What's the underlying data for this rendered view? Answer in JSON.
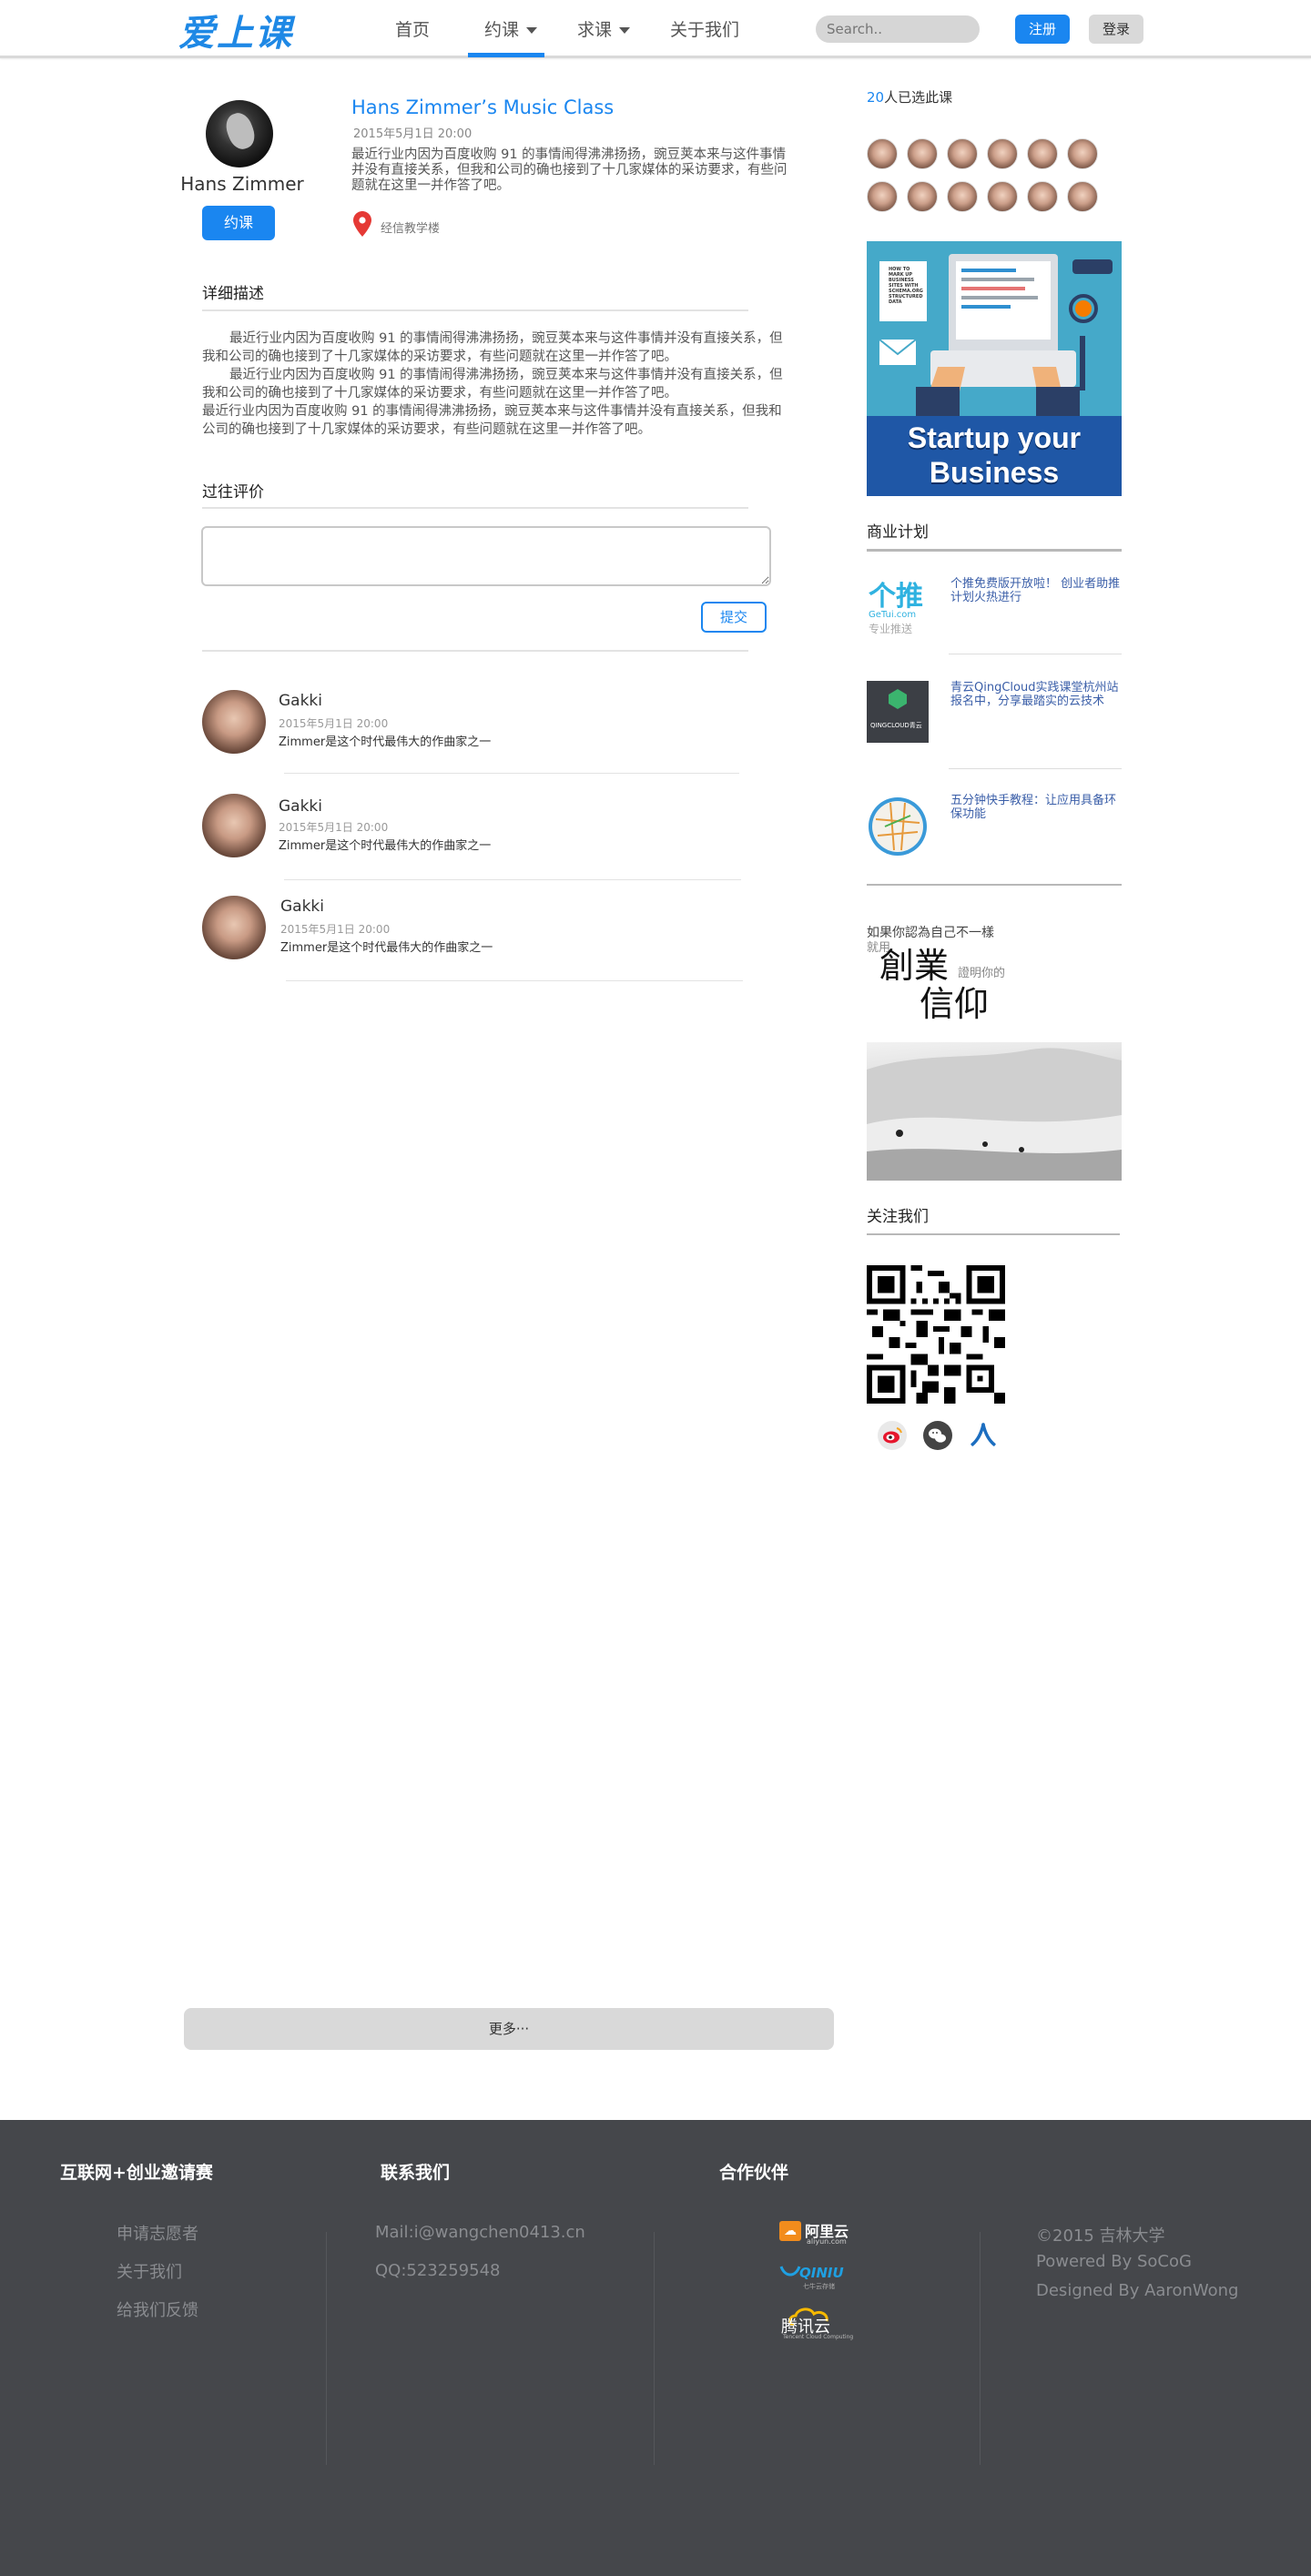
{
  "header": {
    "logo": "爱上课",
    "nav": [
      "首页",
      "约课",
      "求课",
      "关于我们"
    ],
    "search_placeholder": "Search..",
    "register": "注册",
    "login": "登录"
  },
  "course": {
    "teacher_name": "Hans Zimmer",
    "book_button": "约课",
    "title": "Hans Zimmer’s Music Class",
    "date": "2015年5月1日 20:00",
    "summary": "最近行业内因为百度收购 91 的事情闹得沸沸扬扬，豌豆荚本来与这件事情并没有直接关系，但我和公司的确也接到了十几家媒体的采访要求，有些问题就在这里一并作答了吧。",
    "location": "经信教学楼"
  },
  "description": {
    "title": "详细描述",
    "paragraphs": [
      "最近行业内因为百度收购 91 的事情闹得沸沸扬扬，豌豆荚本来与这件事情并没有直接关系，但我和公司的确也接到了十几家媒体的采访要求，有些问题就在这里一并作答了吧。",
      "最近行业内因为百度收购 91 的事情闹得沸沸扬扬，豌豆荚本来与这件事情并没有直接关系，但我和公司的确也接到了十几家媒体的采访要求，有些问题就在这里一并作答了吧。",
      "最近行业内因为百度收购 91 的事情闹得沸沸扬扬，豌豆荚本来与这件事情并没有直接关系，但我和公司的确也接到了十几家媒体的采访要求，有些问题就在这里一并作答了吧。"
    ]
  },
  "reviews": {
    "title": "过往评价",
    "submit": "提交",
    "comments": [
      {
        "name": "Gakki",
        "date": "2015年5月1日 20:00",
        "text": "Zimmer是这个时代最伟大的作曲家之一"
      },
      {
        "name": "Gakki",
        "date": "2015年5月1日 20:00",
        "text": "Zimmer是这个时代最伟大的作曲家之一"
      },
      {
        "name": "Gakki",
        "date": "2015年5月1日 20:00",
        "text": "Zimmer是这个时代最伟大的作曲家之一"
      }
    ]
  },
  "sidebar": {
    "selected_count": "20",
    "selected_suffix": "人已选此课",
    "promo_line1": "Startup your",
    "promo_line2": "Business",
    "promo_screen_text": "HOW TO MARK UP BUSINESS SITES WITH SCHEMA.ORG STRUCTURED DATA",
    "biz_title": "商业计划",
    "biz_items": [
      {
        "text": "个推免费版开放啦！ 创业者助推计划火热进行",
        "logo": "个推",
        "logo_sub": "GeTui.com",
        "logo_sub2": "专业推送"
      },
      {
        "text": "青云QingCloud实践课堂杭州站报名中，分享最踏实的云技术",
        "logo": "QINGCLOUD青云"
      },
      {
        "text": "五分钟快手教程：让应用具备环保功能"
      }
    ],
    "poster_line1": "如果你認為自己不一樣",
    "poster_line2": "就用",
    "poster_big1": "創業",
    "poster_small": "證明你的",
    "poster_big2": "信仰",
    "follow_title": "关注我们"
  },
  "more_button": "更多···",
  "footer": {
    "col1_title": "互联网+创业邀请赛",
    "col1_links": [
      "申请志愿者",
      "关于我们",
      "给我们反馈"
    ],
    "col2_title": "联系我们",
    "col2_links": [
      "Mail:i@wangchen0413.cn",
      "QQ:523259548"
    ],
    "col3_title": "合作伙伴",
    "partners": [
      {
        "name": "阿里云",
        "sub": "aliyun.com"
      },
      {
        "name": "QINIU",
        "sub": "七牛云存储"
      },
      {
        "name": "腾讯云",
        "sub": "Tencent Cloud Computing"
      }
    ],
    "col4_lines": [
      "©2015 吉林大学",
      "Powered By SoCoG",
      "Designed By AaronWong"
    ]
  },
  "colors": {
    "accent": "#1a86f0",
    "footer_bg": "#45474b"
  }
}
